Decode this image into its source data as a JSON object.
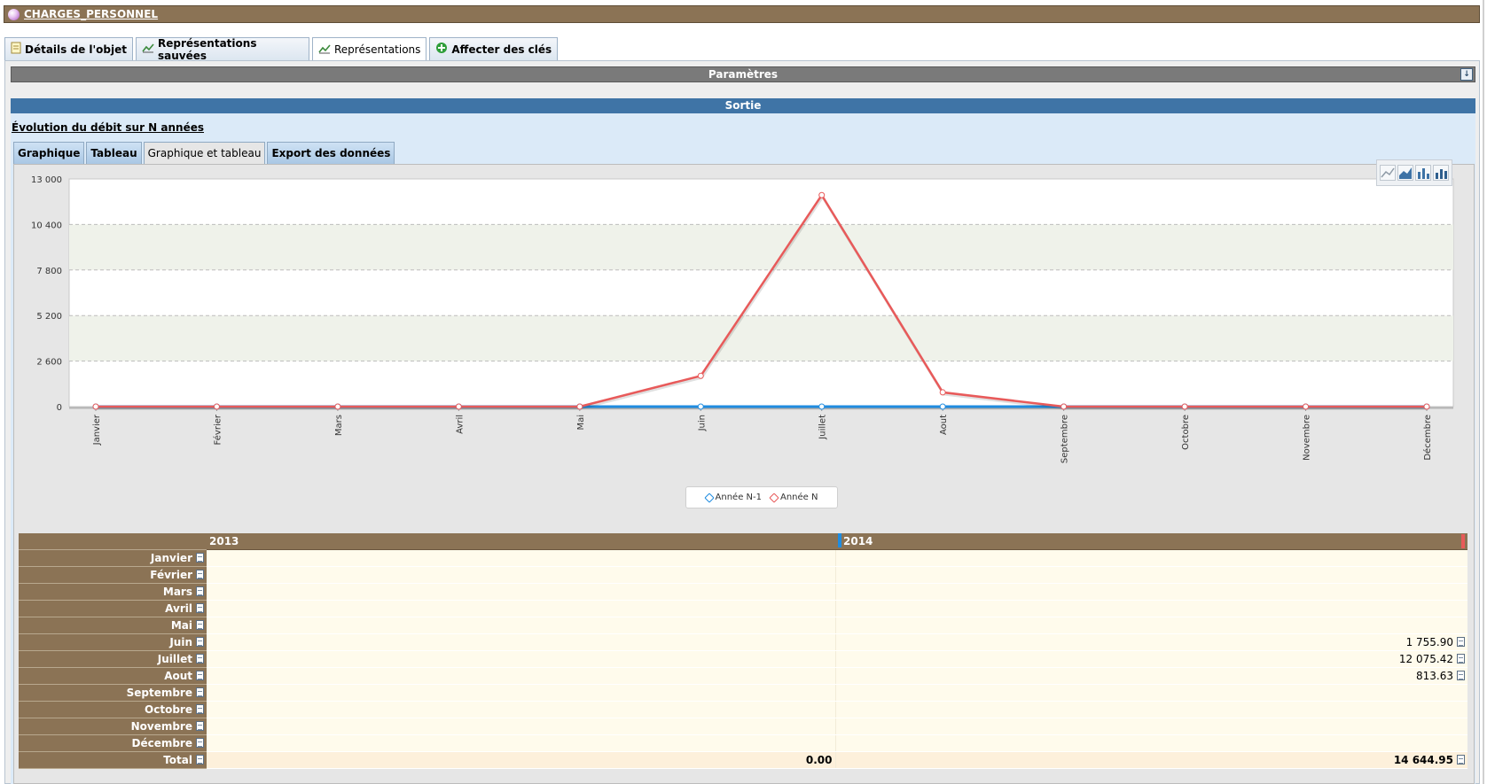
{
  "window": {
    "title": "CHARGES_PERSONNEL"
  },
  "main_tabs": [
    {
      "label": "Détails de l'objet",
      "icon": "document-icon"
    },
    {
      "label": "Représentations sauvées",
      "icon": "chart-icon"
    },
    {
      "label": "Représentations",
      "icon": "chart-icon",
      "active": true
    },
    {
      "label": "Affecter des clés",
      "icon": "add-icon"
    }
  ],
  "params": {
    "label": "Paramètres"
  },
  "output": {
    "label": "Sortie",
    "report_link": "Évolution du débit sur N années"
  },
  "sub_tabs": [
    {
      "label": "Graphique"
    },
    {
      "label": "Tableau"
    },
    {
      "label": "Graphique et tableau",
      "active": true
    },
    {
      "label": "Export des données"
    }
  ],
  "chart_tools": [
    "line-chart-icon",
    "area-chart-icon",
    "bar-chart-icon",
    "bar-3d-chart-icon"
  ],
  "chart_data": {
    "type": "line",
    "categories": [
      "Janvier",
      "Février",
      "Mars",
      "Avril",
      "Mai",
      "Juin",
      "Juillet",
      "Aout",
      "Septembre",
      "Octobre",
      "Novembre",
      "Décembre"
    ],
    "ylim": [
      0,
      13000
    ],
    "yticks": [
      "0",
      "2 600",
      "5 200",
      "7 800",
      "10 400",
      "13 000"
    ],
    "grid": true,
    "legend_position": "bottom-center",
    "series": [
      {
        "name": "Année N-1",
        "color": "#1f8ce0",
        "values": [
          0,
          0,
          0,
          0,
          0,
          0,
          0,
          0,
          0,
          0,
          0,
          0
        ]
      },
      {
        "name": "Année N",
        "color": "#e85a5a",
        "values": [
          0,
          0,
          0,
          0,
          0,
          1755.9,
          12075.42,
          813.63,
          0,
          0,
          0,
          0
        ]
      }
    ]
  },
  "table": {
    "years": [
      "2013",
      "2014"
    ],
    "rows": [
      {
        "label": "Janvier",
        "v2013": "",
        "v2014": ""
      },
      {
        "label": "Février",
        "v2013": "",
        "v2014": ""
      },
      {
        "label": "Mars",
        "v2013": "",
        "v2014": ""
      },
      {
        "label": "Avril",
        "v2013": "",
        "v2014": ""
      },
      {
        "label": "Mai",
        "v2013": "",
        "v2014": ""
      },
      {
        "label": "Juin",
        "v2013": "",
        "v2014": "1 755.90"
      },
      {
        "label": "Juillet",
        "v2013": "",
        "v2014": "12 075.42"
      },
      {
        "label": "Aout",
        "v2013": "",
        "v2014": "813.63"
      },
      {
        "label": "Septembre",
        "v2013": "",
        "v2014": ""
      },
      {
        "label": "Octobre",
        "v2013": "",
        "v2014": ""
      },
      {
        "label": "Novembre",
        "v2013": "",
        "v2014": ""
      },
      {
        "label": "Décembre",
        "v2013": "",
        "v2014": ""
      }
    ],
    "total": {
      "label": "Total",
      "v2013": "0.00",
      "v2014": "14 644.95"
    }
  }
}
